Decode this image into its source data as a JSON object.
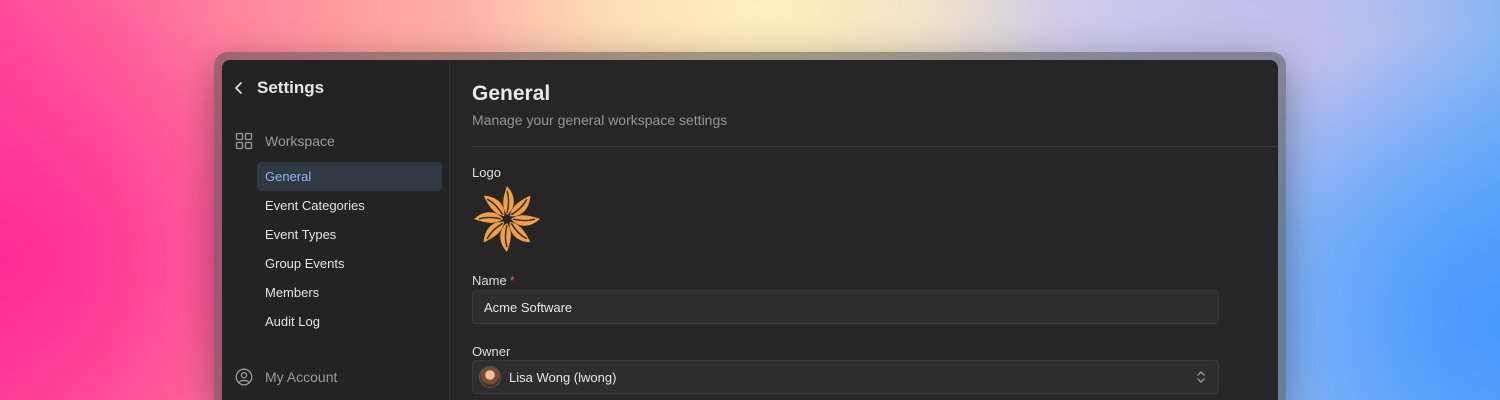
{
  "sidebar": {
    "title": "Settings",
    "workspace_label": "Workspace",
    "items": [
      {
        "label": "General",
        "active": true
      },
      {
        "label": "Event Categories"
      },
      {
        "label": "Event Types"
      },
      {
        "label": "Group Events"
      },
      {
        "label": "Members"
      },
      {
        "label": "Audit Log"
      }
    ],
    "account_label": "My Account"
  },
  "main": {
    "title": "General",
    "subtitle": "Manage your general workspace settings",
    "logo_label": "Logo",
    "name_label": "Name",
    "name_required_mark": "*",
    "name_value": "Acme Software",
    "owner_label": "Owner",
    "owner_value": "Lisa Wong (lwong)"
  },
  "colors": {
    "accent": "#8ab8ee",
    "active_bg": "#303844",
    "logo": "#f0a040"
  }
}
